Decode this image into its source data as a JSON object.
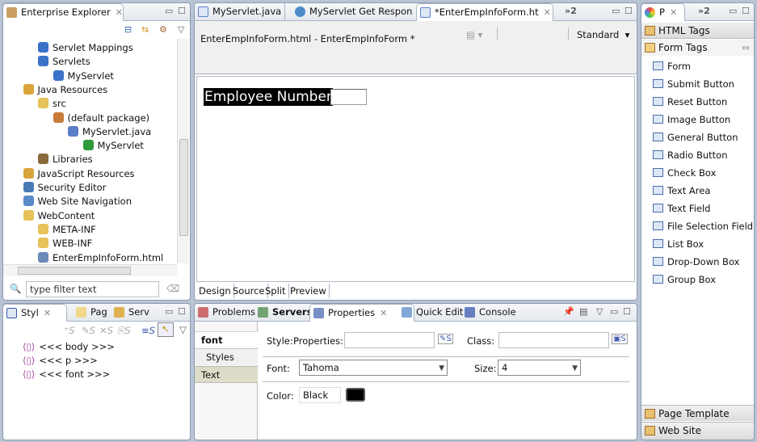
{
  "explorer": {
    "title": "Enterprise Explorer",
    "filter_placeholder": "type filter text",
    "tree": [
      {
        "label": "Servlet Mappings",
        "depth": 2,
        "icon": "servlet-mappings-icon",
        "color": "#3a72c8"
      },
      {
        "label": "Servlets",
        "depth": 2,
        "icon": "servlets-icon",
        "color": "#3a72c8"
      },
      {
        "label": "MyServlet",
        "depth": 3,
        "icon": "servlet-icon",
        "color": "#3a72c8"
      },
      {
        "label": "Java Resources",
        "depth": 1,
        "icon": "java-resources-icon",
        "color": "#d9a53a"
      },
      {
        "label": "src",
        "depth": 2,
        "icon": "source-folder-icon",
        "color": "#e6c25a"
      },
      {
        "label": "(default package)",
        "depth": 3,
        "icon": "package-icon",
        "color": "#c87a3a"
      },
      {
        "label": "MyServlet.java",
        "depth": 4,
        "icon": "java-file-icon",
        "color": "#5a7ec8"
      },
      {
        "label": "MyServlet",
        "depth": 5,
        "icon": "class-icon",
        "color": "#2e9a3a"
      },
      {
        "label": "Libraries",
        "depth": 2,
        "icon": "libraries-icon",
        "color": "#8a6a3a"
      },
      {
        "label": "JavaScript Resources",
        "depth": 1,
        "icon": "javascript-resources-icon",
        "color": "#d9a53a"
      },
      {
        "label": "Security Editor",
        "depth": 1,
        "icon": "security-editor-icon",
        "color": "#4a7ab8"
      },
      {
        "label": "Web Site Navigation",
        "depth": 1,
        "icon": "web-site-navigation-icon",
        "color": "#5a8ac8"
      },
      {
        "label": "WebContent",
        "depth": 1,
        "icon": "folder-icon",
        "color": "#e6c25a"
      },
      {
        "label": "META-INF",
        "depth": 2,
        "icon": "folder-icon",
        "color": "#e6c25a"
      },
      {
        "label": "WEB-INF",
        "depth": 2,
        "icon": "folder-icon",
        "color": "#e6c25a"
      },
      {
        "label": "EnterEmpInfoForm.html",
        "depth": 2,
        "icon": "html-file-icon",
        "color": "#6a8ab8"
      }
    ]
  },
  "styles_panel": {
    "tabs": [
      "Styl",
      "Pag",
      "Serv"
    ],
    "items": [
      "<<< body >>>",
      "<<< p >>>",
      "<<< font >>>"
    ]
  },
  "editor": {
    "tabs": [
      "MyServlet.java",
      "MyServlet Get Respon",
      "*EnterEmpInfoForm.ht"
    ],
    "overflow": "»2",
    "title": "EnterEmpInfoForm.html - EnterEmpInfoForm *",
    "mode": "Standard",
    "content_label": "Employee Number",
    "view_tabs": [
      "Design",
      "Source",
      "Split",
      "Preview"
    ]
  },
  "bottom": {
    "tabs": [
      "Problems",
      "Servers",
      "Properties",
      "Quick Edit",
      "Console"
    ],
    "side_tabs": [
      "font",
      "Styles",
      "Text"
    ],
    "style_label": "Style:",
    "properties_label": "Properties:",
    "properties_value": "",
    "class_label": "Class:",
    "class_value": "",
    "font_label": "Font:",
    "font_value": "Tahoma",
    "size_label": "Size:",
    "size_value": "4",
    "color_label": "Color:",
    "color_value": "Black",
    "color_swatch": "#000000"
  },
  "palette": {
    "tab": "P",
    "overflow": "»2",
    "drawers": [
      "HTML Tags",
      "Form Tags"
    ],
    "items": [
      "Form",
      "Submit Button",
      "Reset Button",
      "Image Button",
      "General Button",
      "Radio Button",
      "Check Box",
      "Text Area",
      "Text Field",
      "File Selection Field",
      "List Box",
      "Drop-Down Box",
      "Group Box"
    ],
    "footer": [
      "Page Template",
      "Web Site Navigation"
    ]
  }
}
